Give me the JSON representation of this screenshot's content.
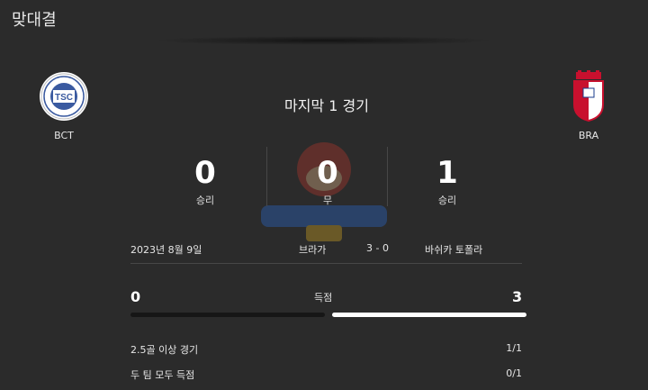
{
  "header": {
    "title": "맞대결"
  },
  "home_team": {
    "abbr": "BCT",
    "logo_icon": "tsc-crest-icon"
  },
  "away_team": {
    "abbr": "BRA",
    "logo_icon": "braga-crest-icon"
  },
  "summary": {
    "title": "마지막 1 경기",
    "wins": {
      "value": "0",
      "label": "승리"
    },
    "draws": {
      "value": "0",
      "label": "무"
    },
    "losses": {
      "value": "1",
      "label": "승리"
    }
  },
  "match": {
    "date": "2023년 8월 9일",
    "home": "브라가",
    "score": "3 - 0",
    "away": "바쉬카 토폴라"
  },
  "goals": {
    "label": "득점",
    "home": "0",
    "away": "3",
    "home_fraction": 0.0,
    "away_fraction": 1.0
  },
  "stats": [
    {
      "label": "2.5골 이상 경기",
      "value": "1/1"
    },
    {
      "label": "두 팀 모두 득점",
      "value": "0/1"
    }
  ],
  "colors": {
    "background": "#2b2b2b",
    "bar_track": "#161616",
    "bar_fill": "#ffffff",
    "braga_red": "#c8102e"
  }
}
